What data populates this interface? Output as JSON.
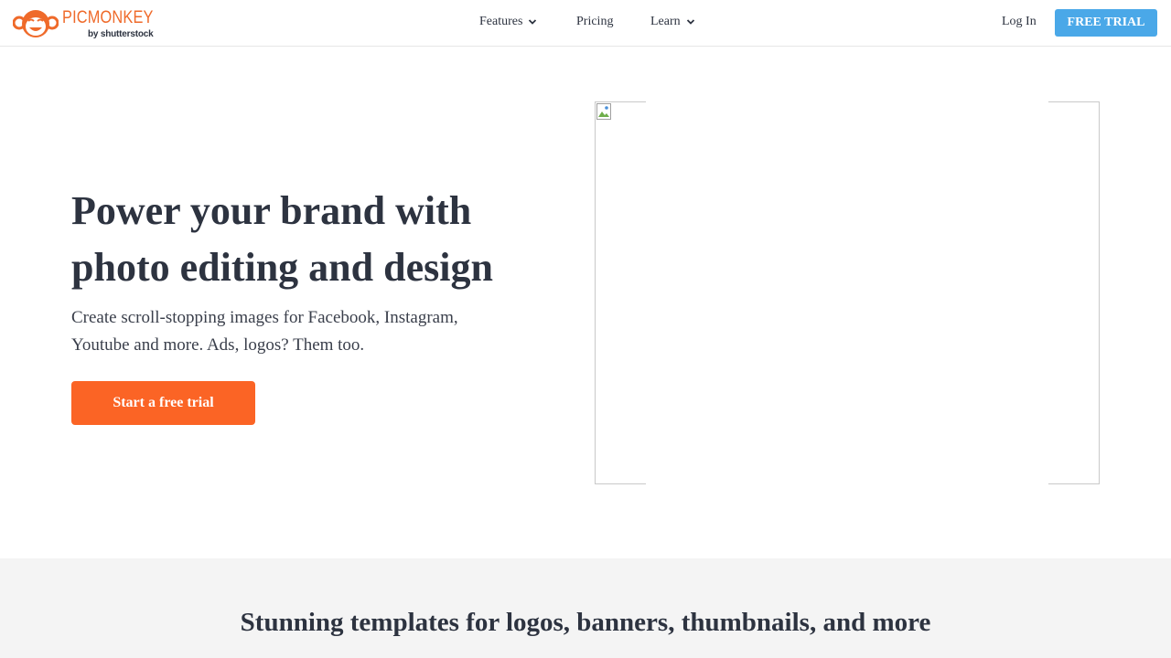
{
  "header": {
    "logo": {
      "wordmark": "PICMONKEY",
      "byline": "by shutterstock"
    },
    "nav": [
      {
        "label": "Features",
        "has_dropdown": true
      },
      {
        "label": "Pricing",
        "has_dropdown": false
      },
      {
        "label": "Learn",
        "has_dropdown": true
      }
    ],
    "login_label": "Log In",
    "free_trial_label": "FREE TRIAL"
  },
  "hero": {
    "title": "Power your brand with photo editing and design",
    "subtitle": "Create scroll-stopping images for Facebook, Instagram, Youtube and more. Ads, logos? Them too.",
    "cta_label": "Start a free trial",
    "image_state": "broken-image-icon"
  },
  "templates": {
    "title": "Stunning templates for logos, banners, thumbnails, and more"
  },
  "colors": {
    "brand_orange": "#ef6a2a",
    "cta_orange": "#fb6425",
    "trial_blue": "#4aa8e8",
    "text_dark": "#2d3340",
    "band_gray": "#f4f4f4"
  }
}
